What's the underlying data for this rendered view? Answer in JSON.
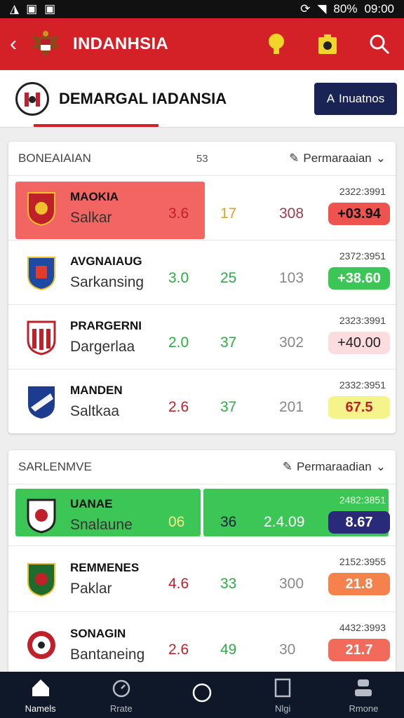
{
  "status": {
    "left": [
      "◮",
      "▣",
      "▣"
    ],
    "battery": "80%",
    "time": "09:00"
  },
  "appbar": {
    "title": "INDANHSIA"
  },
  "subheader": {
    "title": "DEMARGAL IADANSIA",
    "button": "Inuatnos"
  },
  "cards": [
    {
      "title": "BONEAIAIAN",
      "count": "53",
      "filter": "Permaraaian",
      "rows": [
        {
          "name": "MAOKIA",
          "sub": "Salkar",
          "v1": "3.6",
          "v2": "17",
          "v3": "308",
          "time": "2322:3991",
          "pill": "+03.94"
        },
        {
          "name": "AVGNAIAUG",
          "sub": "Sarkansing",
          "v1": "3.0",
          "v2": "25",
          "v3": "103",
          "time": "2372:3951",
          "pill": "+38.60"
        },
        {
          "name": "PRARGERNI",
          "sub": "Dargerlaa",
          "v1": "2.0",
          "v2": "37",
          "v3": "302",
          "time": "2323:3991",
          "pill": "+40.00"
        },
        {
          "name": "MANDEN",
          "sub": "Saltkaa",
          "v1": "2.6",
          "v2": "37",
          "v3": "201",
          "time": "2332:3951",
          "pill": "67.5"
        }
      ]
    },
    {
      "title": "SARLENMVE",
      "filter": "Permaraadian",
      "rows": [
        {
          "name": "UANAE",
          "sub": "Snalaune",
          "v1": "06",
          "v2": "36",
          "v3": "2.4.09",
          "time": "2482:3851",
          "pill": "8.67"
        },
        {
          "name": "REMMENES",
          "sub": "Paklar",
          "v1": "4.6",
          "v2": "33",
          "v3": "300",
          "time": "2152:3955",
          "pill": "21.8"
        },
        {
          "name": "SONAGIN",
          "sub": "Bantaneing",
          "v1": "2.6",
          "v2": "49",
          "v3": "30",
          "time": "4432:3993",
          "pill": "21.7"
        }
      ]
    }
  ],
  "nav": [
    "Namels",
    "Rrate",
    "",
    "Nlgi",
    "Rmone"
  ],
  "colors": {
    "brand_red": "#d42027",
    "navy": "#1a2454",
    "green": "#3cc655"
  }
}
